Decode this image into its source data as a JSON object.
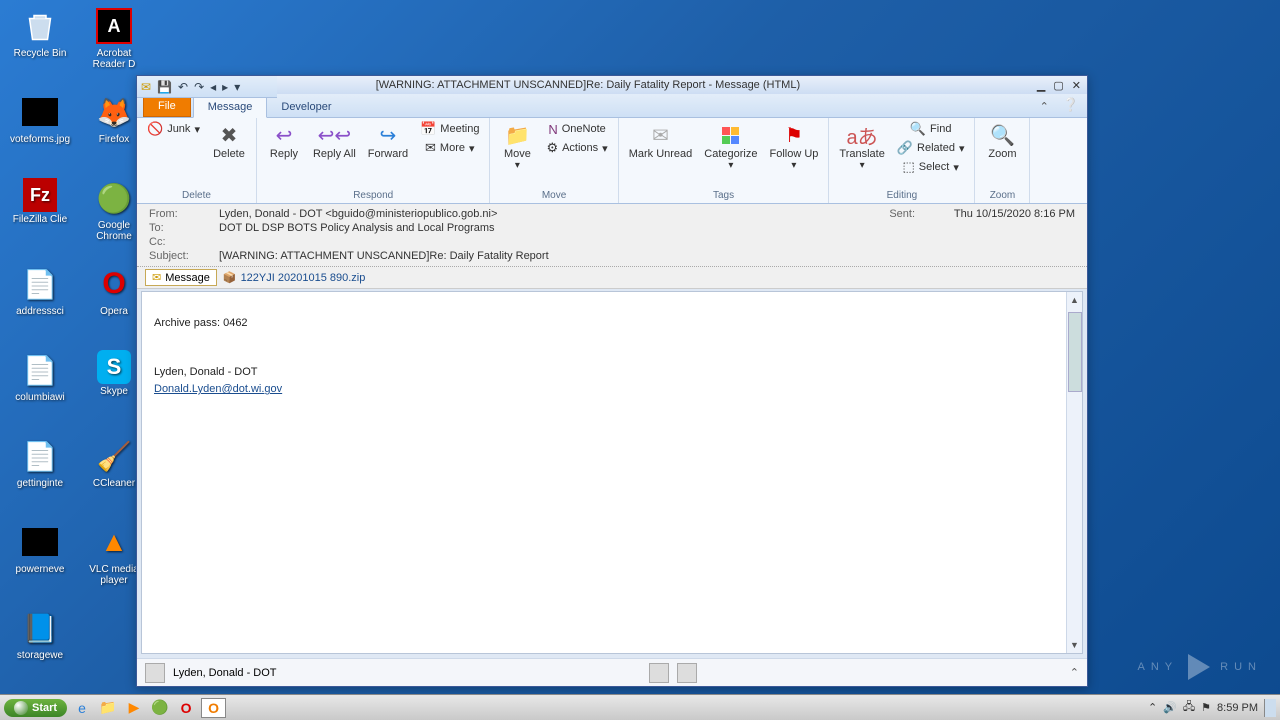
{
  "desktop": {
    "icons": [
      {
        "name": "recycle-bin",
        "label": "Recycle Bin"
      },
      {
        "name": "acrobat",
        "label": "Acrobat Reader D"
      },
      {
        "name": "voteforms",
        "label": "voteforms.jpg"
      },
      {
        "name": "firefox",
        "label": "Firefox"
      },
      {
        "name": "filezilla",
        "label": "FileZilla Clie"
      },
      {
        "name": "chrome",
        "label": "Google Chrome"
      },
      {
        "name": "addresssci",
        "label": "addresssci"
      },
      {
        "name": "opera",
        "label": "Opera"
      },
      {
        "name": "columbiawi",
        "label": "columbiawi"
      },
      {
        "name": "skype",
        "label": "Skype"
      },
      {
        "name": "gettinginte",
        "label": "gettinginte"
      },
      {
        "name": "ccleaner",
        "label": "CCleaner"
      },
      {
        "name": "powerneve",
        "label": "powerneve"
      },
      {
        "name": "vlc",
        "label": "VLC media player"
      },
      {
        "name": "storagewe",
        "label": "storagewe"
      }
    ]
  },
  "window": {
    "title": "[WARNING: ATTACHMENT UNSCANNED]Re: Daily Fatality Report  -  Message (HTML)",
    "tabs": {
      "file": "File",
      "message": "Message",
      "developer": "Developer"
    },
    "ribbon": {
      "delete": {
        "junk": "Junk",
        "delete": "Delete",
        "group": "Delete"
      },
      "respond": {
        "reply": "Reply",
        "replyall": "Reply All",
        "forward": "Forward",
        "meeting": "Meeting",
        "more": "More",
        "group": "Respond"
      },
      "move": {
        "move": "Move",
        "onenote": "OneNote",
        "actions": "Actions",
        "group": "Move"
      },
      "tags": {
        "markunread": "Mark Unread",
        "categorize": "Categorize",
        "followup": "Follow Up",
        "group": "Tags"
      },
      "editing": {
        "translate": "Translate",
        "find": "Find",
        "related": "Related",
        "select": "Select",
        "group": "Editing"
      },
      "zoom": {
        "zoom": "Zoom",
        "group": "Zoom"
      }
    },
    "headers": {
      "from_lbl": "From:",
      "from": "Lyden, Donald - DOT <bguido@ministeriopublico.gob.ni>",
      "to_lbl": "To:",
      "to": "DOT DL DSP BOTS Policy Analysis and Local Programs",
      "cc_lbl": "Cc:",
      "cc": "",
      "subject_lbl": "Subject:",
      "subject": "[WARNING: ATTACHMENT UNSCANNED]Re: Daily Fatality Report",
      "sent_lbl": "Sent:",
      "sent": "Thu 10/15/2020 8:16 PM"
    },
    "attach": {
      "msgtab": "Message",
      "file": "122YJI 20201015 890.zip"
    },
    "body": {
      "archive": "Archive pass: 0462",
      "signer": "Lyden, Donald - DOT",
      "email": "Donald.Lyden@dot.wi.gov"
    },
    "people": {
      "name": "Lyden, Donald - DOT"
    }
  },
  "taskbar": {
    "start": "Start",
    "clock": "8:59 PM"
  },
  "watermark": {
    "a": "ANY",
    "b": "RUN"
  }
}
